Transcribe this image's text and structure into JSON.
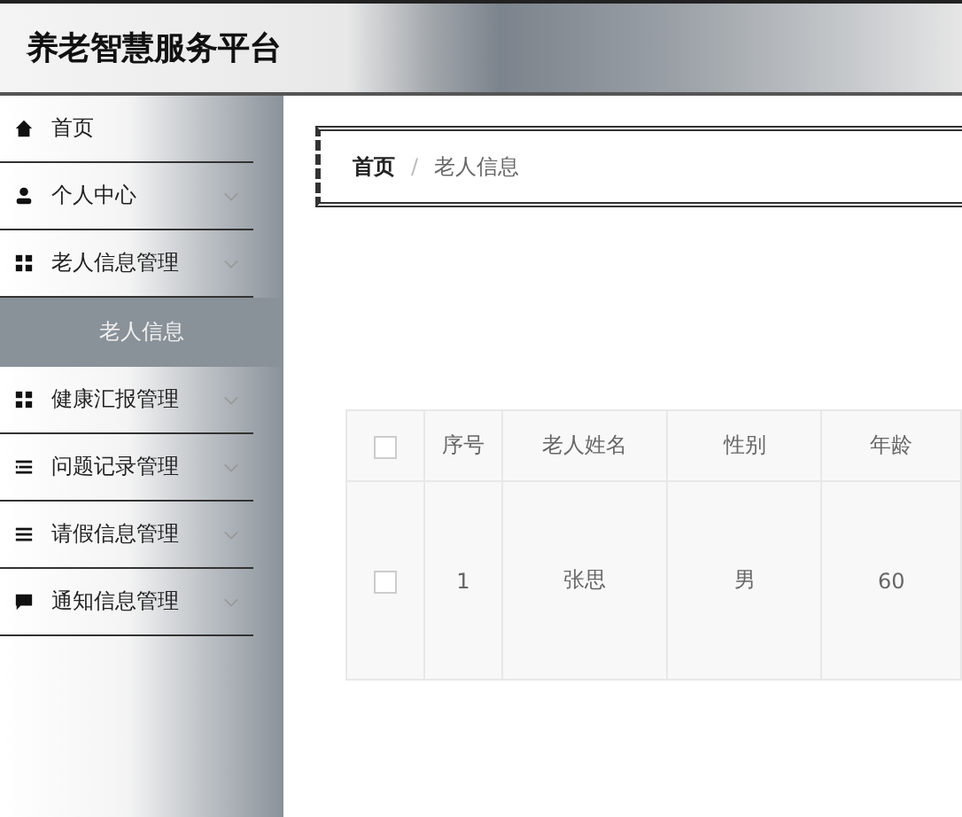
{
  "header": {
    "title": "养老智慧服务平台"
  },
  "sidebar": {
    "items": [
      {
        "label": "首页",
        "expandable": false
      },
      {
        "label": "个人中心",
        "expandable": true
      },
      {
        "label": "老人信息管理",
        "expandable": true,
        "children": [
          {
            "label": "老人信息",
            "selected": true
          }
        ]
      },
      {
        "label": "健康汇报管理",
        "expandable": true
      },
      {
        "label": "问题记录管理",
        "expandable": true
      },
      {
        "label": "请假信息管理",
        "expandable": true
      },
      {
        "label": "通知信息管理",
        "expandable": true
      }
    ]
  },
  "breadcrumb": {
    "items": [
      "首页",
      "老人信息"
    ],
    "separator": "/"
  },
  "table": {
    "columns": [
      "序号",
      "老人姓名",
      "性别",
      "年龄"
    ],
    "rows": [
      {
        "checked": false,
        "cells": [
          "1",
          "张思",
          "男",
          "60"
        ]
      }
    ],
    "header_checked": false
  }
}
